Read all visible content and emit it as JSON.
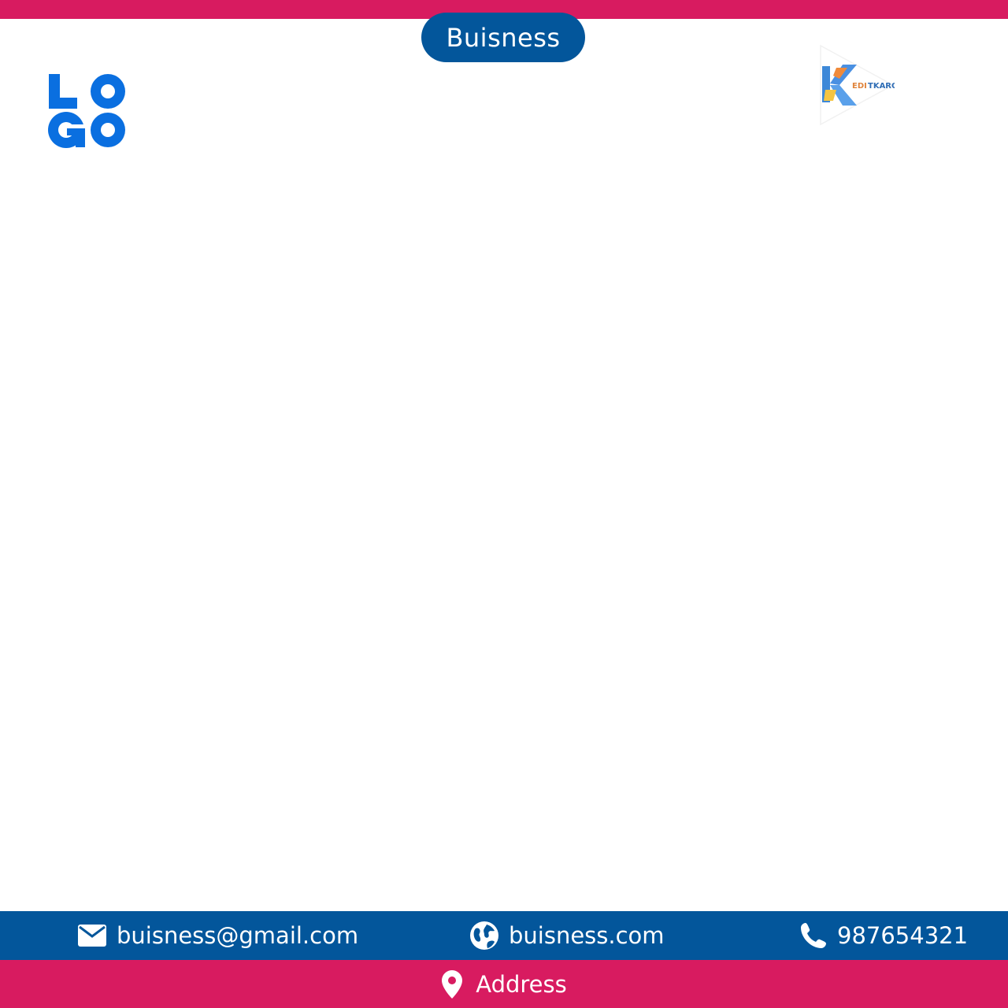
{
  "header": {
    "title": "Buisness",
    "logo_text": "LOGO",
    "brand_logo_text": "EDITKARO"
  },
  "contact": {
    "email": "buisness@gmail.com",
    "website": "buisness.com",
    "phone": "987654321"
  },
  "footer": {
    "address": "Address"
  },
  "icons": {
    "email": "mail-icon",
    "website": "globe-icon",
    "phone": "phone-icon",
    "address": "location-pin-icon"
  },
  "colors": {
    "accent_pink": "#d81b60",
    "primary_blue": "#03569b",
    "logo_blue": "#0a6fe0",
    "background": "#ffffff"
  }
}
